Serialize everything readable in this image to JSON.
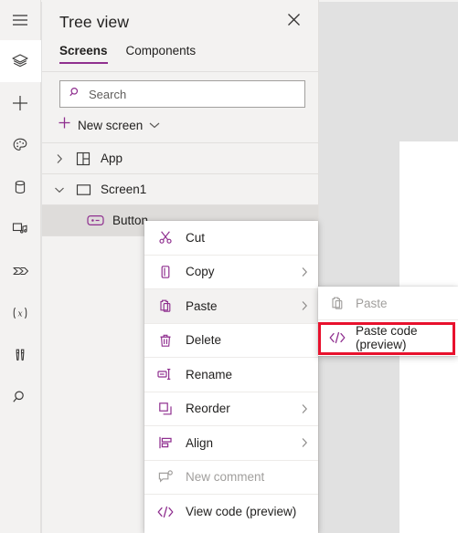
{
  "app": {
    "accent_color": "#8f2f8f",
    "highlight_color": "#e8112d",
    "panel_bg": "#f3f2f1",
    "canvas_bg": "#e1e1e1"
  },
  "rail": {
    "items": [
      {
        "name": "hamburger-icon",
        "label": "Menu",
        "selected": false
      },
      {
        "name": "layers-icon",
        "label": "Tree view",
        "selected": true
      },
      {
        "name": "plus-icon",
        "label": "Insert",
        "selected": false
      },
      {
        "name": "palette-icon",
        "label": "Themes",
        "selected": false
      },
      {
        "name": "database-icon",
        "label": "Data",
        "selected": false
      },
      {
        "name": "media-icon",
        "label": "Media",
        "selected": false
      },
      {
        "name": "powerautomate-icon",
        "label": "Power Automate",
        "selected": false
      },
      {
        "name": "variables-icon",
        "label": "Variables",
        "selected": false
      },
      {
        "name": "tools-icon",
        "label": "App checker",
        "selected": false
      },
      {
        "name": "search-icon",
        "label": "Search",
        "selected": false
      }
    ]
  },
  "panel": {
    "title": "Tree view",
    "close_label": "Close",
    "tabs": [
      {
        "label": "Screens",
        "active": true
      },
      {
        "label": "Components",
        "active": false
      }
    ],
    "search": {
      "placeholder": "Search",
      "value": ""
    },
    "new_screen": {
      "label": "New screen"
    },
    "tree": [
      {
        "label": "App",
        "icon": "app-grid-icon",
        "twisty": "collapsed",
        "depth": 0,
        "selected": false,
        "ellipsis": false
      },
      {
        "label": "Screen1",
        "icon": "screen-icon",
        "twisty": "expanded",
        "depth": 0,
        "selected": false,
        "ellipsis": false
      },
      {
        "label": "Button",
        "icon": "button-control-icon",
        "twisty": "none",
        "depth": 1,
        "selected": true,
        "ellipsis": true
      }
    ]
  },
  "context_menu": {
    "items": [
      {
        "label": "Cut",
        "icon": "scissors-icon",
        "submenu": false,
        "disabled": false,
        "hovered": false
      },
      {
        "label": "Copy",
        "icon": "copy-icon",
        "submenu": true,
        "disabled": false,
        "hovered": false
      },
      {
        "label": "Paste",
        "icon": "paste-icon",
        "submenu": true,
        "disabled": false,
        "hovered": true
      },
      {
        "label": "Delete",
        "icon": "trash-icon",
        "submenu": false,
        "disabled": false,
        "hovered": false
      },
      {
        "label": "Rename",
        "icon": "rename-icon",
        "submenu": false,
        "disabled": false,
        "hovered": false
      },
      {
        "label": "Reorder",
        "icon": "reorder-icon",
        "submenu": true,
        "disabled": false,
        "hovered": false
      },
      {
        "label": "Align",
        "icon": "align-icon",
        "submenu": true,
        "disabled": false,
        "hovered": false
      },
      {
        "label": "New comment",
        "icon": "comment-icon",
        "submenu": false,
        "disabled": true,
        "hovered": false
      },
      {
        "label": "View code (preview)",
        "icon": "code-icon",
        "submenu": false,
        "disabled": false,
        "hovered": false
      }
    ]
  },
  "submenu": {
    "items": [
      {
        "label": "Paste",
        "icon": "paste-icon",
        "disabled": true,
        "highlighted": false
      },
      {
        "label": "Paste code (preview)",
        "icon": "code-icon",
        "disabled": false,
        "highlighted": true
      }
    ]
  }
}
